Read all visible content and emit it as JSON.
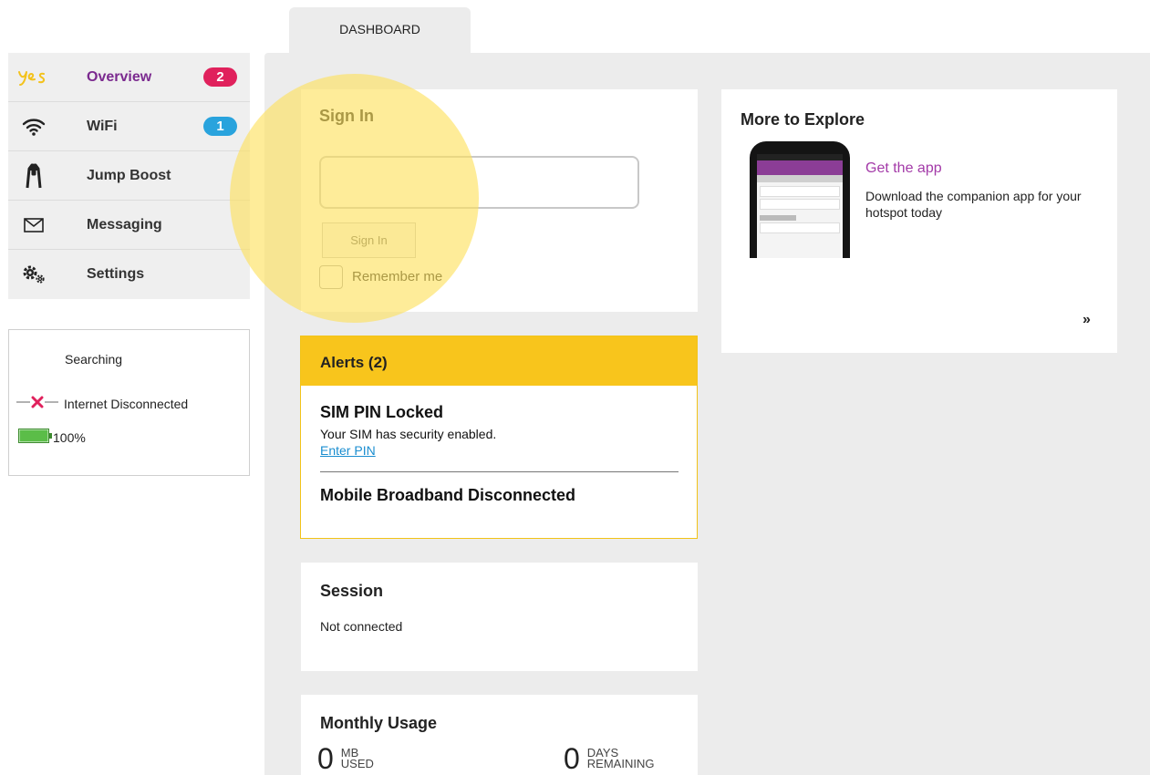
{
  "tab": {
    "label": "DASHBOARD"
  },
  "brand": {
    "logo_text": "yes"
  },
  "sidebar": {
    "items": [
      {
        "label": "Overview",
        "badge": "2",
        "badge_color": "#e0215c",
        "active": true,
        "icon": "yes-logo"
      },
      {
        "label": "WiFi",
        "badge": "1",
        "badge_color": "#29a3dd",
        "icon": "wifi-icon"
      },
      {
        "label": "Jump Boost",
        "icon": "jump-boost-icon"
      },
      {
        "label": "Messaging",
        "icon": "envelope-icon"
      },
      {
        "label": "Settings",
        "icon": "gears-icon"
      }
    ]
  },
  "status": {
    "network": "Searching",
    "internet": "Internet Disconnected",
    "battery": "100%",
    "battery_level": 1.0
  },
  "signin": {
    "title": "Sign In",
    "button_label": "Sign In",
    "remember_label": "Remember me"
  },
  "alerts": {
    "title": "Alerts (2)",
    "items": [
      {
        "title": "SIM PIN Locked",
        "desc": "Your SIM has security enabled.",
        "link": "Enter PIN"
      },
      {
        "title": "Mobile Broadband Disconnected"
      }
    ]
  },
  "session": {
    "title": "Session",
    "status": "Not connected"
  },
  "monthly_usage": {
    "title": "Monthly Usage",
    "used_value": "0",
    "used_unit_1": "MB",
    "used_unit_2": "USED",
    "days_value": "0",
    "days_unit_1": "DAYS",
    "days_unit_2": "REMAINING"
  },
  "explore": {
    "title": "More to Explore",
    "link": "Get the app",
    "desc": "Download the companion app for your hotspot today",
    "more": "»"
  },
  "colors": {
    "accent_purple": "#7b2a8f",
    "alert_yellow": "#f8c51c",
    "link_blue": "#1b8ed0",
    "badge_red": "#e0215c",
    "badge_blue": "#29a3dd"
  }
}
